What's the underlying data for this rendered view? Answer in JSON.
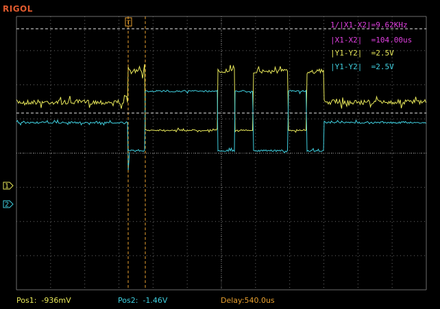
{
  "brand": "RIGOL",
  "trigger_marker": "T",
  "colors": {
    "background": "#000000",
    "grid": "#6e6e6e",
    "grid_dots": "#8a8a8a",
    "ch1": "#e8e85a",
    "ch2": "#40d0e0",
    "cursor_x": "#e8a030",
    "cursor_y": "#e8e8e8",
    "measurement_x": "#e040e0",
    "measurement_y1": "#e8e85a",
    "measurement_y2": "#40d0e0",
    "pos1": "#e8e85a",
    "pos2": "#40d0e0",
    "delay": "#e8a030",
    "brand": "#e05a2e"
  },
  "channels": [
    {
      "id": "ch1",
      "label": "1"
    },
    {
      "id": "ch2",
      "label": "2"
    }
  ],
  "measurements": [
    {
      "text": "1/|X1-X2|=9.62KHz",
      "color_key": "measurement_x"
    },
    {
      "text": "|X1-X2|  =104.00us",
      "color_key": "measurement_x"
    },
    {
      "text": "|Y1-Y2|  =2.5V",
      "color_key": "measurement_y1"
    },
    {
      "text": "|Y1-Y2|  =2.5V",
      "color_key": "measurement_y2"
    }
  ],
  "status": {
    "pos1": "Pos1:  -936mV",
    "pos2": "Pos2:  -1.46V",
    "delay": "Delay:540.0us"
  }
}
